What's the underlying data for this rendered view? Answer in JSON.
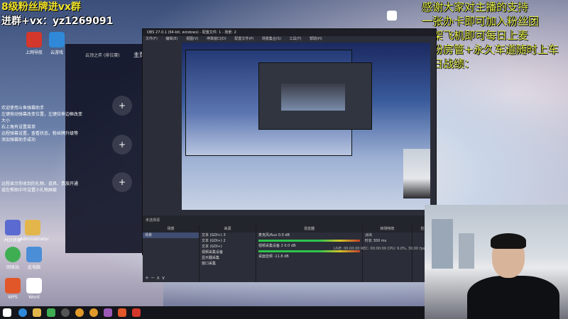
{
  "overlay": {
    "left_line1": "8级粉丝牌进vx群",
    "left_line2": "进群+vx：yz1269091",
    "right_lines": [
      "感谢大家对主播的支持",
      "一张办卡即可加入粉丝团",
      "一架飞机即可每日上麦",
      "钻粉房管+永久车道随时上车",
      "今日战绩："
    ]
  },
  "chat": {
    "tab_label": "主页",
    "rank_label": "云顶之弈 (排位赛)",
    "help_lines": [
      "欢迎使用斗鱼弹幕助手",
      "左键拖动弹幕改变位置，左键拉伸边框改变大小",
      "右上角有设置菜单",
      "远程弹幕设置，查看状态，粉丝牌升级等",
      "添加弹幕助手成功"
    ],
    "help_lines2": [
      "远程显示你收到的礼物、道具、贵族开通",
      "或在帮助中可设置小礼物屏蔽"
    ],
    "plus": "+"
  },
  "obs": {
    "title": "OBS 27.0.1 (64-bit, windows) - 配置文件: 1 - 场景: 2",
    "menu": [
      "文件(F)",
      "编辑(E)",
      "视图(V)",
      "停靠窗口(D)",
      "配置文件(P)",
      "场景集合(S)",
      "工具(T)",
      "帮助(H)"
    ],
    "status_label": "未选择源",
    "docks": {
      "scenes": {
        "header": "场景",
        "items": [
          "场景"
        ]
      },
      "sources": {
        "header": "来源",
        "items": [
          "文本 (GDI+) 3",
          "文本 (GDI+) 2",
          "文本 (GDI+)",
          "视频采集设备",
          "显示器采集",
          "窗口采集"
        ]
      },
      "mixer": {
        "header": "混音器",
        "items": [
          "麦克风/Aux",
          "视频采集设备 2",
          "桌面音频"
        ],
        "levels": [
          "0.0 dB",
          "0.0 dB",
          "-11.8 dB"
        ]
      },
      "transitions": {
        "header": "转场特效",
        "fade": "淡出",
        "duration_label": "时长",
        "duration": "300 ms"
      },
      "controls": {
        "header": "控件"
      }
    },
    "footer": "LIVE: 00:00:00   REC: 00:00:00   CPU: 9.0%, 30.00 fps"
  },
  "desktop": {
    "icons": [
      "上网导航",
      "云游戏",
      "Administrator",
      "此电脑",
      "PDF转换",
      "回收站",
      "微信",
      "WPS",
      "Word"
    ]
  }
}
